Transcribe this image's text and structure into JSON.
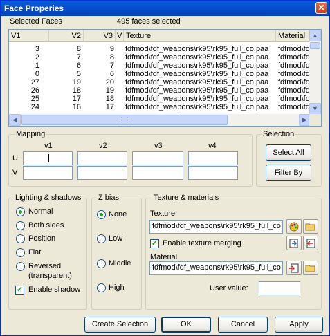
{
  "window": {
    "title": "Face Properies",
    "close_glyph": "✕"
  },
  "selected": {
    "label": "Selected Faces",
    "count_text": "495  faces selected"
  },
  "list": {
    "columns": [
      "V1",
      "V2",
      "V3",
      "V",
      "Texture",
      "Material"
    ],
    "rows": [
      [
        "3",
        "8",
        "9",
        "fdfmod\\fdf_weapons\\rk95\\rk95_full_co.paa",
        "fdfmod\\fd"
      ],
      [
        "2",
        "7",
        "8",
        "fdfmod\\fdf_weapons\\rk95\\rk95_full_co.paa",
        "fdfmod\\fd"
      ],
      [
        "1",
        "6",
        "7",
        "fdfmod\\fdf_weapons\\rk95\\rk95_full_co.paa",
        "fdfmod\\fd"
      ],
      [
        "0",
        "5",
        "6",
        "fdfmod\\fdf_weapons\\rk95\\rk95_full_co.paa",
        "fdfmod\\fd"
      ],
      [
        "27",
        "19",
        "20",
        "fdfmod\\fdf_weapons\\rk95\\rk95_full_co.paa",
        "fdfmod\\fd"
      ],
      [
        "26",
        "18",
        "19",
        "fdfmod\\fdf_weapons\\rk95\\rk95_full_co.paa",
        "fdfmod\\fd"
      ],
      [
        "25",
        "17",
        "18",
        "fdfmod\\fdf_weapons\\rk95\\rk95_full_co.paa",
        "fdfmod\\fd"
      ],
      [
        "24",
        "16",
        "17",
        "fdfmod\\fdf_weapons\\rk95\\rk95_full_co.paa",
        "fdfmod\\fd"
      ]
    ]
  },
  "mapping": {
    "title": "Mapping",
    "columns": [
      "v1",
      "v2",
      "v3",
      "v4"
    ],
    "rows": [
      "U",
      "V"
    ]
  },
  "selection": {
    "title": "Selection",
    "select_all": "Select All",
    "filter_by": "Filter By"
  },
  "lighting": {
    "title": "Lighting & shadows",
    "options": [
      "Normal",
      "Both sides",
      "Position",
      "Flat",
      "Reversed"
    ],
    "reversed_note": "(transparent)",
    "selected": "Normal",
    "enable_shadow": "Enable shadow",
    "enable_shadow_checked": true
  },
  "zbias": {
    "title": "Z bias",
    "options": [
      "None",
      "Low",
      "Middle",
      "High"
    ],
    "selected": "None"
  },
  "texture": {
    "title": "Texture & materials",
    "texture_label": "Texture",
    "texture_value": "fdfmod\\fdf_weapons\\rk95\\rk95_full_co",
    "merging_label": "Enable texture merging",
    "merging_checked": true,
    "material_label": "Material",
    "material_value": "fdfmod\\fdf_weapons\\rk95\\rk95_full_co",
    "user_value_label": "User value:",
    "user_value": ""
  },
  "icons": [
    "palette-icon",
    "folder-icon",
    "import-icon",
    "export-icon",
    "material-edit-icon",
    "folder-icon"
  ],
  "footer": {
    "create_selection": "Create Selection",
    "ok": "OK",
    "cancel": "Cancel",
    "apply": "Apply"
  },
  "colors": {
    "title_bar": "#0550d0",
    "dialog_bg": "#ece9d8",
    "radio_dot": "#21a121"
  }
}
